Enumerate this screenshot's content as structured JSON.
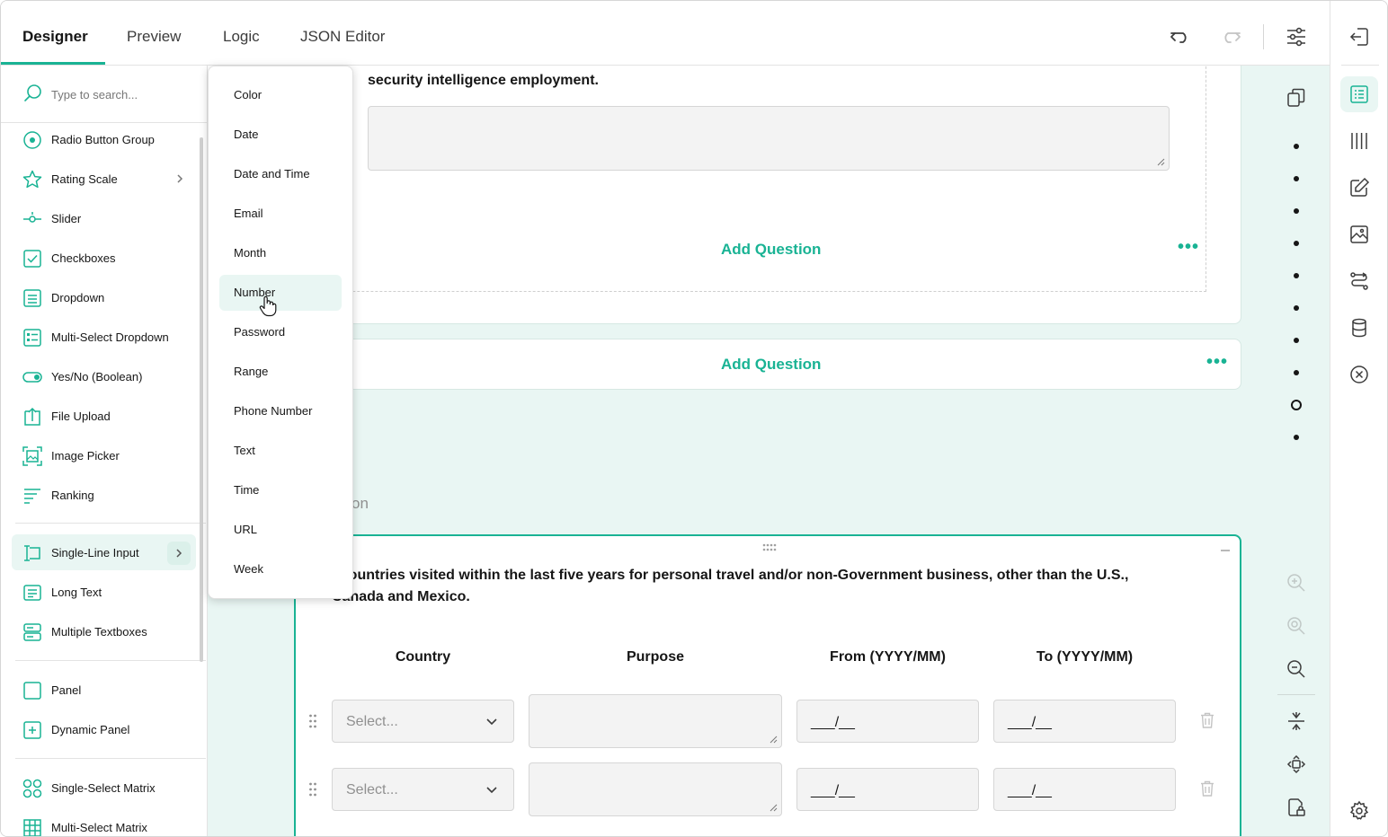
{
  "tabs": [
    {
      "label": "Designer",
      "active": true
    },
    {
      "label": "Preview",
      "active": false
    },
    {
      "label": "Logic",
      "active": false
    },
    {
      "label": "JSON Editor",
      "active": false
    }
  ],
  "toolbar": {
    "undo_icon": "undo-icon",
    "redo_icon": "redo-icon",
    "settings_icon": "sliders-icon"
  },
  "toolbox": {
    "search_placeholder": "Type to search...",
    "items": [
      {
        "label": "Radio Button Group",
        "icon": "radio-icon"
      },
      {
        "label": "Rating Scale",
        "icon": "star-icon",
        "has_submenu": true
      },
      {
        "label": "Slider",
        "icon": "slider-icon"
      },
      {
        "label": "Checkboxes",
        "icon": "checkbox-icon"
      },
      {
        "label": "Dropdown",
        "icon": "dropdown-icon"
      },
      {
        "label": "Multi-Select Dropdown",
        "icon": "multi-dropdown-icon"
      },
      {
        "label": "Yes/No (Boolean)",
        "icon": "toggle-icon"
      },
      {
        "label": "File Upload",
        "icon": "file-upload-icon"
      },
      {
        "label": "Image Picker",
        "icon": "image-picker-icon"
      },
      {
        "label": "Ranking",
        "icon": "ranking-icon"
      },
      {
        "label": "Single-Line Input",
        "icon": "single-line-input-icon",
        "has_submenu": true,
        "highlighted": true
      },
      {
        "label": "Long Text",
        "icon": "long-text-icon"
      },
      {
        "label": "Multiple Textboxes",
        "icon": "multiple-textboxes-icon"
      },
      {
        "label": "Panel",
        "icon": "panel-icon"
      },
      {
        "label": "Dynamic Panel",
        "icon": "dynamic-panel-icon"
      },
      {
        "label": "Single-Select Matrix",
        "icon": "single-matrix-icon"
      },
      {
        "label": "Multi-Select Matrix",
        "icon": "multi-matrix-icon"
      }
    ]
  },
  "input_type_menu": {
    "items": [
      "Color",
      "Date",
      "Date and Time",
      "Email",
      "Month",
      "Number",
      "Password",
      "Range",
      "Phone Number",
      "Text",
      "Time",
      "URL",
      "Week"
    ],
    "hovered": "Number"
  },
  "canvas": {
    "question1_text": "security intelligence employment.",
    "add_question_1": "Add Question",
    "add_question_2": "Add Question",
    "more_dots": "•••",
    "faded_text": "on",
    "question2_text_line1": "t countries visited within the last five years for personal travel and/or non-Government business, other than the U.S.,",
    "question2_text_line2": "Canada and Mexico.",
    "matrix": {
      "columns": [
        "Country",
        "Purpose",
        "From  (YYYY/MM)",
        "To (YYYY/MM)"
      ],
      "rows": [
        {
          "country": "Select...",
          "from": "___/__",
          "to": "___/__"
        },
        {
          "country": "Select...",
          "from": "___/__",
          "to": "___/__"
        }
      ]
    }
  },
  "colors": {
    "accent": "#19b394",
    "canvas_bg": "#e9f6f3",
    "text": "#161616",
    "muted": "#909090"
  }
}
